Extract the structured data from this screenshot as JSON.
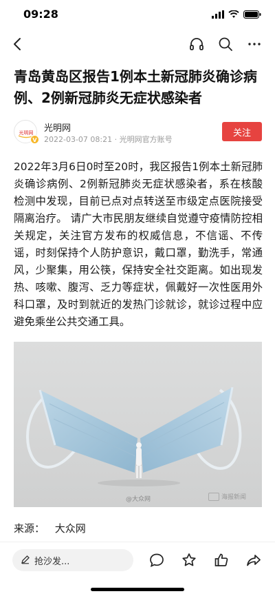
{
  "status_bar": {
    "time": "09:28",
    "icons": [
      "cellular-signal-icon",
      "wifi-icon",
      "battery-icon"
    ]
  },
  "nav": {
    "icons": [
      "back-arrow-icon",
      "headphones-icon",
      "search-icon",
      "more-icon"
    ]
  },
  "article": {
    "title": "青岛黄岛区报告1例本土新冠肺炎确诊病例、2例新冠肺炎无症状感染者",
    "author": {
      "avatar_text": "光明网",
      "name": "光明网",
      "meta": "2022-03-07 08:21 · 光明网官方账号",
      "badge": "V"
    },
    "follow_label": "关注",
    "body": "2022年3月6日0时至20时，我区报告1例本土新冠肺炎确诊病例、2例新冠肺炎无症状感染者，系在核酸检测中发现，目前已点对点转送至市级定点医院接受隔离治疗。 请广大市民朋友继续自觉遵守疫情防控相关规定，关注官方发布的权威信息，不信谣、不传谣，时刻保持个人防护意识，戴口罩，勤洗手，常通风，少聚集，用公筷，保持安全社交距离。如出现发热、咳嗽、腹泻、乏力等症状，佩戴好一次性医用外科口罩，及时到就近的发热门诊就诊，就诊过程中应避免乘坐公共交通工具。",
    "image": {
      "watermark_left": "@大众网",
      "watermark_right": "海报新闻"
    },
    "source_label": "来源：",
    "source_value": "大众网"
  },
  "bottom_bar": {
    "comment_placeholder": "抢沙发...",
    "icons": [
      "comment-icon",
      "star-icon",
      "like-icon",
      "share-icon"
    ]
  },
  "colors": {
    "follow_button": "#e64340",
    "badge": "#f6b72a",
    "mask_blue": "#a8c9de"
  }
}
